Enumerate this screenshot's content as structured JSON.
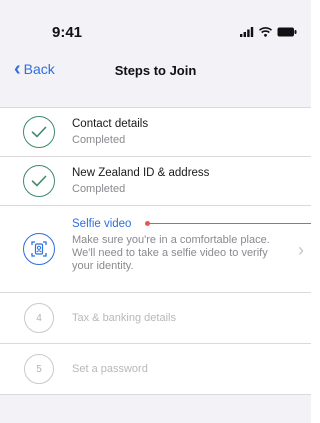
{
  "status_bar": {
    "time": "9:41"
  },
  "nav": {
    "back_label": "Back",
    "title": "Steps to Join"
  },
  "steps": [
    {
      "title": "Contact details",
      "status": "Completed",
      "state": "completed",
      "icon": "checkmark-icon"
    },
    {
      "title": "New Zealand ID & address",
      "status": "Completed",
      "state": "completed",
      "icon": "checkmark-icon"
    },
    {
      "title": "Selfie video",
      "description": "Make sure you're in a comfortable place. We'll need to take a selfie video to verify your identity.",
      "state": "active",
      "icon": "selfie-scan-icon"
    },
    {
      "number": "4",
      "title": "Tax & banking details",
      "state": "pending"
    },
    {
      "number": "5",
      "title": "Set a password",
      "state": "pending"
    }
  ],
  "colors": {
    "accent": "#2f6fde",
    "completed": "#3f8a6b",
    "annotation": "#e8584a"
  }
}
